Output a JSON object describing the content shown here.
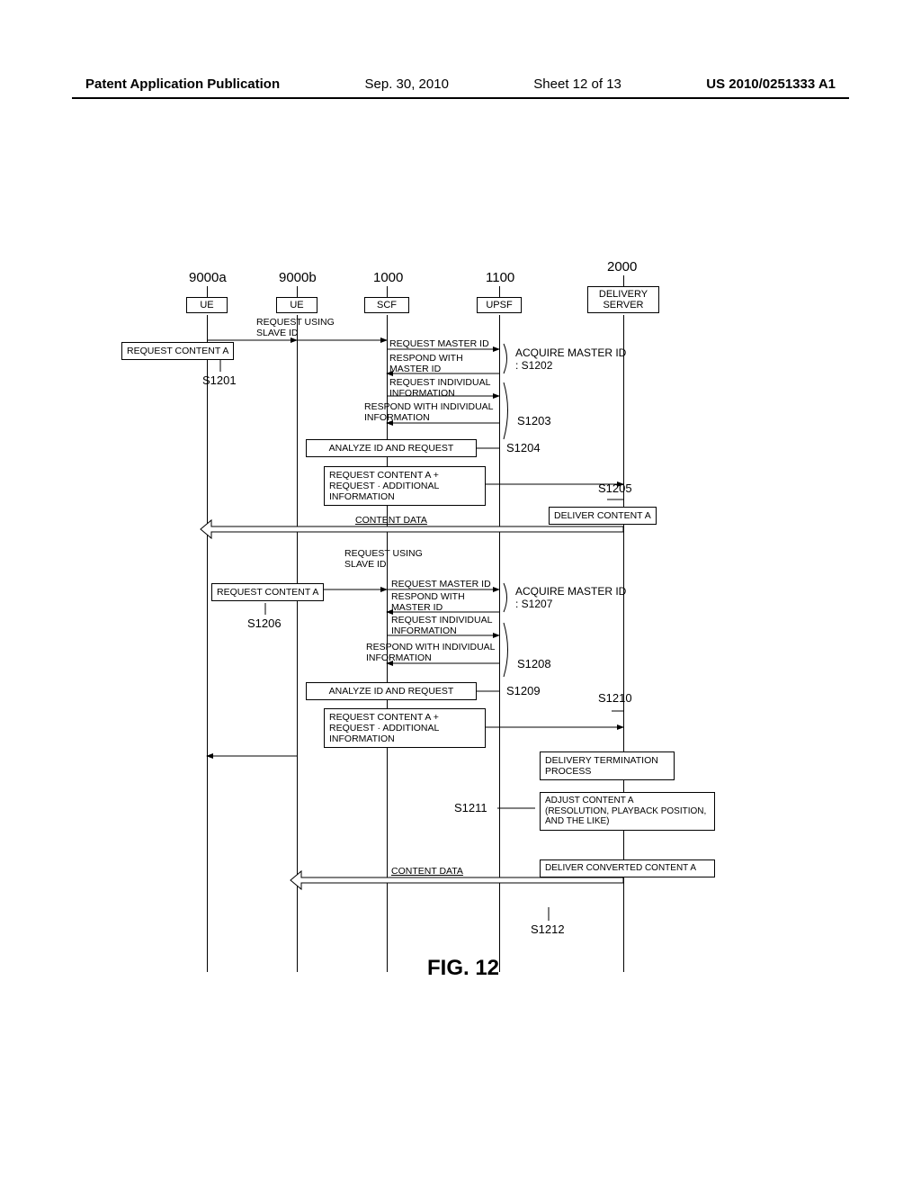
{
  "header": {
    "left": "Patent Application Publication",
    "date": "Sep. 30, 2010",
    "sheet": "Sheet 12 of 13",
    "pubno": "US 2010/0251333 A1"
  },
  "figure_caption": "FIG. 12",
  "lanes": {
    "ue_a": {
      "num": "9000a",
      "label": "UE"
    },
    "ue_b": {
      "num": "9000b",
      "label": "UE"
    },
    "scf": {
      "num": "1000",
      "label": "SCF"
    },
    "upsf": {
      "num": "1100",
      "label": "UPSF"
    },
    "ds": {
      "num": "2000",
      "label": "DELIVERY\nSERVER"
    }
  },
  "steps": {
    "s1201": "S1201",
    "s1202": "ACQUIRE MASTER ID\n: S1202",
    "s1203": "S1203",
    "s1204": "S1204",
    "s1205": "S1205",
    "s1206": "S1206",
    "s1207": "ACQUIRE MASTER ID\n: S1207",
    "s1208": "S1208",
    "s1209": "S1209",
    "s1210": "S1210",
    "s1211": "S1211",
    "s1212": "S1212"
  },
  "messages": {
    "req_content_a": "REQUEST CONTENT A",
    "req_slave_id": "REQUEST USING\nSLAVE ID",
    "req_master_id": "REQUEST MASTER ID",
    "resp_master_id": "RESPOND WITH\nMASTER ID",
    "req_indiv": "REQUEST INDIVIDUAL\nINFORMATION",
    "resp_indiv": "RESPOND WITH INDIVIDUAL\nINFORMATION",
    "analyze": "ANALYZE ID AND REQUEST",
    "req_content_plus": "REQUEST CONTENT A +\nREQUEST · ADDITIONAL\nINFORMATION",
    "deliver_a": "DELIVER CONTENT A",
    "content_data": "CONTENT DATA",
    "term": "DELIVERY TERMINATION\nPROCESS",
    "adjust": "ADJUST CONTENT A\n(RESOLUTION, PLAYBACK POSITION,\nAND THE LIKE)",
    "deliver_conv": "DELIVER CONVERTED CONTENT A"
  }
}
